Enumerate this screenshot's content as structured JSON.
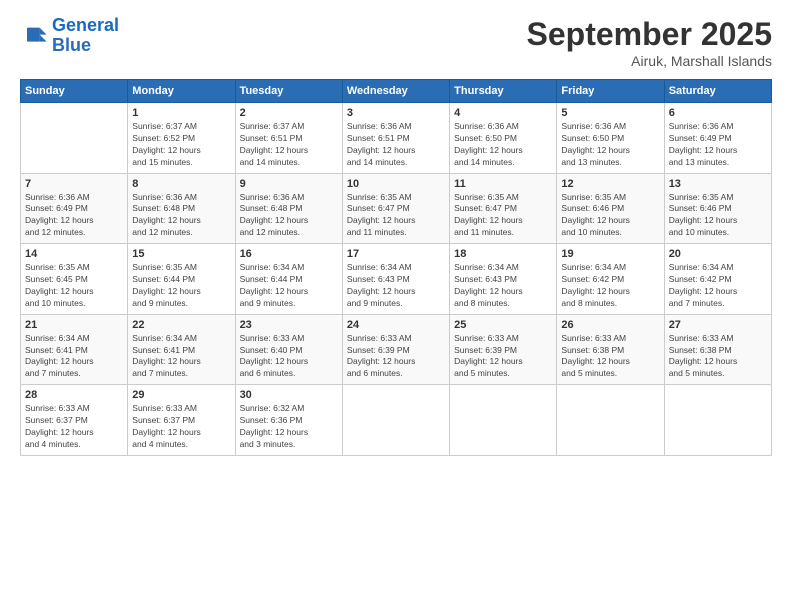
{
  "header": {
    "logo_general": "General",
    "logo_blue": "Blue",
    "month_title": "September 2025",
    "location": "Airuk, Marshall Islands"
  },
  "days_of_week": [
    "Sunday",
    "Monday",
    "Tuesday",
    "Wednesday",
    "Thursday",
    "Friday",
    "Saturday"
  ],
  "weeks": [
    [
      {
        "day": "",
        "info": ""
      },
      {
        "day": "1",
        "info": "Sunrise: 6:37 AM\nSunset: 6:52 PM\nDaylight: 12 hours\nand 15 minutes."
      },
      {
        "day": "2",
        "info": "Sunrise: 6:37 AM\nSunset: 6:51 PM\nDaylight: 12 hours\nand 14 minutes."
      },
      {
        "day": "3",
        "info": "Sunrise: 6:36 AM\nSunset: 6:51 PM\nDaylight: 12 hours\nand 14 minutes."
      },
      {
        "day": "4",
        "info": "Sunrise: 6:36 AM\nSunset: 6:50 PM\nDaylight: 12 hours\nand 14 minutes."
      },
      {
        "day": "5",
        "info": "Sunrise: 6:36 AM\nSunset: 6:50 PM\nDaylight: 12 hours\nand 13 minutes."
      },
      {
        "day": "6",
        "info": "Sunrise: 6:36 AM\nSunset: 6:49 PM\nDaylight: 12 hours\nand 13 minutes."
      }
    ],
    [
      {
        "day": "7",
        "info": "Sunrise: 6:36 AM\nSunset: 6:49 PM\nDaylight: 12 hours\nand 12 minutes."
      },
      {
        "day": "8",
        "info": "Sunrise: 6:36 AM\nSunset: 6:48 PM\nDaylight: 12 hours\nand 12 minutes."
      },
      {
        "day": "9",
        "info": "Sunrise: 6:36 AM\nSunset: 6:48 PM\nDaylight: 12 hours\nand 12 minutes."
      },
      {
        "day": "10",
        "info": "Sunrise: 6:35 AM\nSunset: 6:47 PM\nDaylight: 12 hours\nand 11 minutes."
      },
      {
        "day": "11",
        "info": "Sunrise: 6:35 AM\nSunset: 6:47 PM\nDaylight: 12 hours\nand 11 minutes."
      },
      {
        "day": "12",
        "info": "Sunrise: 6:35 AM\nSunset: 6:46 PM\nDaylight: 12 hours\nand 10 minutes."
      },
      {
        "day": "13",
        "info": "Sunrise: 6:35 AM\nSunset: 6:46 PM\nDaylight: 12 hours\nand 10 minutes."
      }
    ],
    [
      {
        "day": "14",
        "info": "Sunrise: 6:35 AM\nSunset: 6:45 PM\nDaylight: 12 hours\nand 10 minutes."
      },
      {
        "day": "15",
        "info": "Sunrise: 6:35 AM\nSunset: 6:44 PM\nDaylight: 12 hours\nand 9 minutes."
      },
      {
        "day": "16",
        "info": "Sunrise: 6:34 AM\nSunset: 6:44 PM\nDaylight: 12 hours\nand 9 minutes."
      },
      {
        "day": "17",
        "info": "Sunrise: 6:34 AM\nSunset: 6:43 PM\nDaylight: 12 hours\nand 9 minutes."
      },
      {
        "day": "18",
        "info": "Sunrise: 6:34 AM\nSunset: 6:43 PM\nDaylight: 12 hours\nand 8 minutes."
      },
      {
        "day": "19",
        "info": "Sunrise: 6:34 AM\nSunset: 6:42 PM\nDaylight: 12 hours\nand 8 minutes."
      },
      {
        "day": "20",
        "info": "Sunrise: 6:34 AM\nSunset: 6:42 PM\nDaylight: 12 hours\nand 7 minutes."
      }
    ],
    [
      {
        "day": "21",
        "info": "Sunrise: 6:34 AM\nSunset: 6:41 PM\nDaylight: 12 hours\nand 7 minutes."
      },
      {
        "day": "22",
        "info": "Sunrise: 6:34 AM\nSunset: 6:41 PM\nDaylight: 12 hours\nand 7 minutes."
      },
      {
        "day": "23",
        "info": "Sunrise: 6:33 AM\nSunset: 6:40 PM\nDaylight: 12 hours\nand 6 minutes."
      },
      {
        "day": "24",
        "info": "Sunrise: 6:33 AM\nSunset: 6:39 PM\nDaylight: 12 hours\nand 6 minutes."
      },
      {
        "day": "25",
        "info": "Sunrise: 6:33 AM\nSunset: 6:39 PM\nDaylight: 12 hours\nand 5 minutes."
      },
      {
        "day": "26",
        "info": "Sunrise: 6:33 AM\nSunset: 6:38 PM\nDaylight: 12 hours\nand 5 minutes."
      },
      {
        "day": "27",
        "info": "Sunrise: 6:33 AM\nSunset: 6:38 PM\nDaylight: 12 hours\nand 5 minutes."
      }
    ],
    [
      {
        "day": "28",
        "info": "Sunrise: 6:33 AM\nSunset: 6:37 PM\nDaylight: 12 hours\nand 4 minutes."
      },
      {
        "day": "29",
        "info": "Sunrise: 6:33 AM\nSunset: 6:37 PM\nDaylight: 12 hours\nand 4 minutes."
      },
      {
        "day": "30",
        "info": "Sunrise: 6:32 AM\nSunset: 6:36 PM\nDaylight: 12 hours\nand 3 minutes."
      },
      {
        "day": "",
        "info": ""
      },
      {
        "day": "",
        "info": ""
      },
      {
        "day": "",
        "info": ""
      },
      {
        "day": "",
        "info": ""
      }
    ]
  ]
}
